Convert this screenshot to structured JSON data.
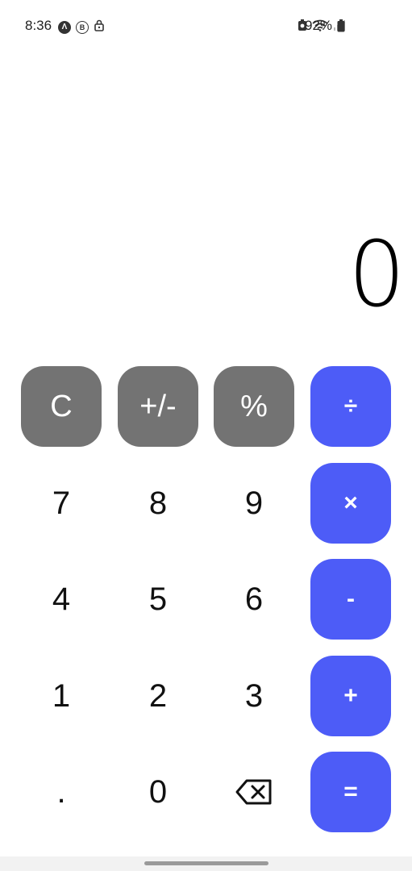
{
  "status_bar": {
    "time": "8:36",
    "battery_percent": "92%",
    "left_icons": [
      "navigation-app-icon",
      "b-badge-icon",
      "lock-icon"
    ],
    "right_icons": [
      "recording-icon",
      "wifi-icon",
      "signal-icon",
      "battery-icon"
    ],
    "badge_a": "Λ",
    "badge_b": "B"
  },
  "display": {
    "value": "0"
  },
  "keys": {
    "clear": "C",
    "negate": "+/-",
    "percent": "%",
    "divide": "÷",
    "seven": "7",
    "eight": "8",
    "nine": "9",
    "multiply": "×",
    "four": "4",
    "five": "5",
    "six": "6",
    "subtract": "-",
    "one": "1",
    "two": "2",
    "three": "3",
    "add": "+",
    "decimal": ".",
    "zero": "0",
    "equals": "="
  },
  "colors": {
    "function_key": "#737373",
    "operator_key": "#4d5cf7",
    "background": "#ffffff"
  }
}
